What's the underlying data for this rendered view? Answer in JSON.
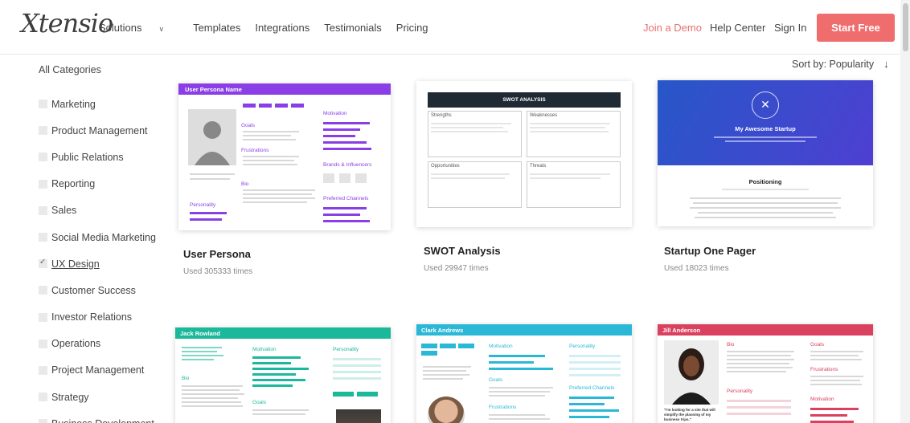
{
  "header": {
    "logo": "Xtensio",
    "nav": [
      {
        "label": "Solutions"
      },
      {
        "label": "Templates"
      },
      {
        "label": "Integrations"
      },
      {
        "label": "Testimonials"
      },
      {
        "label": "Pricing"
      }
    ],
    "join_demo": "Join a Demo",
    "help_center": "Help Center",
    "sign_in": "Sign In",
    "start_free": "Start Free"
  },
  "sidebar": {
    "all_categories": "All Categories",
    "items": [
      {
        "label": "Marketing",
        "checked": false
      },
      {
        "label": "Product Management",
        "checked": false
      },
      {
        "label": "Public Relations",
        "checked": false
      },
      {
        "label": "Reporting",
        "checked": false
      },
      {
        "label": "Sales",
        "checked": false
      },
      {
        "label": "Social Media Marketing",
        "checked": false
      },
      {
        "label": "UX Design",
        "checked": true
      },
      {
        "label": "Customer Success",
        "checked": false
      },
      {
        "label": "Investor Relations",
        "checked": false
      },
      {
        "label": "Operations",
        "checked": false
      },
      {
        "label": "Project Management",
        "checked": false
      },
      {
        "label": "Strategy",
        "checked": false
      },
      {
        "label": "Business Development",
        "checked": false
      }
    ]
  },
  "sort": {
    "label": "Sort by: Popularity"
  },
  "cards": [
    {
      "title": "User Persona",
      "used": "Used 305333 times",
      "preview": {
        "header": "User Persona Name",
        "goals": "Goals",
        "frustrations": "Frustrations",
        "bio": "Bio",
        "personality": "Personality",
        "motivation": "Motivation",
        "brands": "Brands & Influencers",
        "channels": "Preferred Channels",
        "color": "#8a3fe6"
      }
    },
    {
      "title": "SWOT Analysis",
      "used": "Used 29947 times",
      "preview": {
        "header": "SWOT ANALYSIS",
        "strengths": "Strengths",
        "weaknesses": "Weaknesses",
        "opportunities": "Opportunities",
        "threats": "Threats",
        "color": "#1f2a35"
      }
    },
    {
      "title": "Startup One Pager",
      "used": "Used 18023 times",
      "preview": {
        "startup": "My Awesome Startup",
        "positioning": "Positioning",
        "color": "#3b4fd8"
      }
    },
    {
      "preview": {
        "header": "Jack Rowland",
        "motivation": "Motivation",
        "personality": "Personality",
        "bio": "Bio",
        "goals": "Goals",
        "color": "#1bb89a"
      }
    },
    {
      "preview": {
        "header": "Clark Andrews",
        "motivation": "Motivation",
        "personality": "Personality",
        "frustrations": "Frustrations",
        "channels": "Preferred Channels",
        "color": "#2bb8d6"
      }
    },
    {
      "preview": {
        "header": "Jill Anderson",
        "bio": "Bio",
        "goals": "Goals",
        "frustrations": "Frustrations",
        "personality": "Personality",
        "motivation": "Motivation",
        "quote": "\"I'm looking for a site that will simplify the planning of my business trips.\"",
        "color": "#d9415e"
      }
    }
  ]
}
